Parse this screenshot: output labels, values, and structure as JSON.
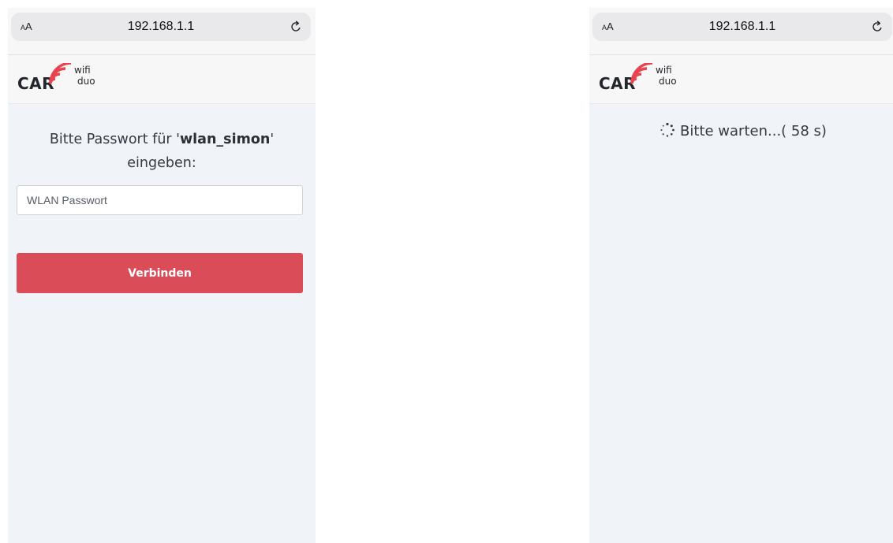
{
  "screens": [
    {
      "browser": {
        "text_size_small": "A",
        "text_size_big": "A",
        "url": "192.168.1.1",
        "reload_icon": "reload-icon"
      },
      "brand": {
        "logo_main": "CAR",
        "logo_wifi": "wifi",
        "logo_duo": "duo",
        "accent_color": "#e8434f"
      },
      "prompt": {
        "line_prefix": "Bitte Passwort für '",
        "ssid": "wlan_simon",
        "line_suffix": "'",
        "line2": "eingeben:"
      },
      "password": {
        "value": "",
        "placeholder": "WLAN Passwort"
      },
      "connect_button": {
        "label": "Verbinden",
        "color": "#da4c58"
      }
    },
    {
      "browser": {
        "text_size_small": "A",
        "text_size_big": "A",
        "url": "192.168.1.1",
        "reload_icon": "reload-icon"
      },
      "brand": {
        "logo_main": "CAR",
        "logo_wifi": "wifi",
        "logo_duo": "duo",
        "accent_color": "#e8434f"
      },
      "status": {
        "spinner_icon": "spinner-icon",
        "text": "Bitte warten...( 58 s)"
      }
    }
  ]
}
